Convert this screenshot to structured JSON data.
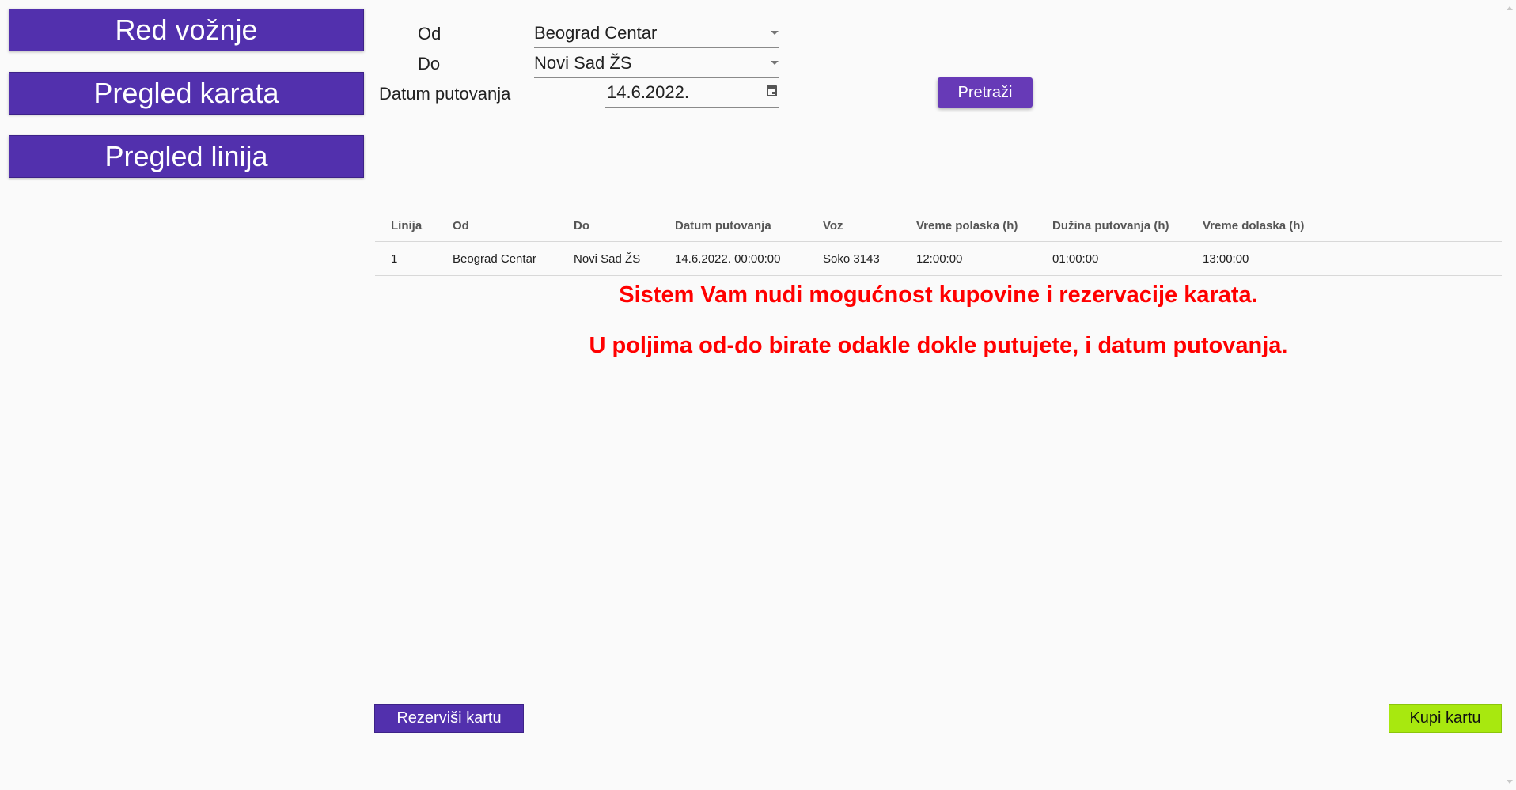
{
  "nav": {
    "items": [
      {
        "label": "Red vožnje"
      },
      {
        "label": "Pregled karata"
      },
      {
        "label": "Pregled linija"
      }
    ]
  },
  "search": {
    "from_label": "Od",
    "from_value": "Beograd Centar",
    "to_label": "Do",
    "to_value": "Novi Sad ŽS",
    "date_label": "Datum putovanja",
    "date_value": "14.6.2022.",
    "search_button": "Pretraži"
  },
  "table": {
    "headers": [
      "Linija",
      "Od",
      "Do",
      "Datum putovanja",
      "Voz",
      "Vreme polaska (h)",
      "Dužina putovanja (h)",
      "Vreme dolaska (h)"
    ],
    "rows": [
      [
        "1",
        "Beograd Centar",
        "Novi Sad ŽS",
        "14.6.2022. 00:00:00",
        "Soko 3143",
        "12:00:00",
        "01:00:00",
        "13:00:00"
      ]
    ]
  },
  "info": {
    "line1": "Sistem Vam nudi mogućnost kupovine i rezervacije karata.",
    "line2": "U poljima od-do birate odakle dokle putujete, i datum putovanja."
  },
  "actions": {
    "reserve": "Rezerviši kartu",
    "buy": "Kupi kartu"
  },
  "colors": {
    "primary": "#5230ad",
    "accent_button": "#673ab7",
    "buy": "#a8e80f",
    "info_text": "#ff0000"
  }
}
